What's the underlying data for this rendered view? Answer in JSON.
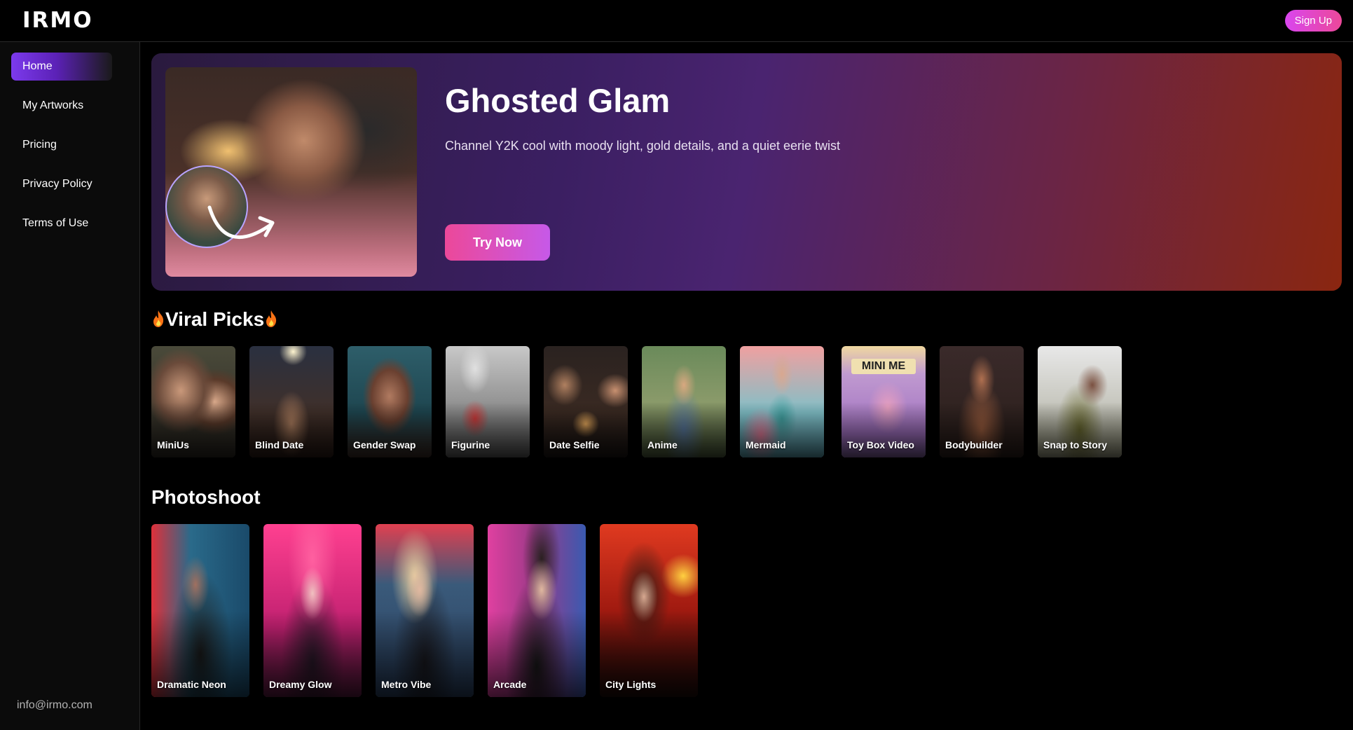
{
  "header": {
    "logo": "IRMO",
    "signup_label": "Sign Up"
  },
  "sidebar": {
    "items": [
      {
        "label": "Home",
        "active": true
      },
      {
        "label": "My Artworks"
      },
      {
        "label": "Pricing"
      },
      {
        "label": "Privacy Policy"
      },
      {
        "label": "Terms of Use"
      }
    ],
    "email": "info@irmo.com"
  },
  "hero": {
    "title": "Ghosted Glam",
    "description": "Channel Y2K cool with moody light, gold details, and a quiet eerie twist",
    "cta_label": "Try Now"
  },
  "viral": {
    "title": "Viral Picks",
    "items": [
      {
        "label": "MiniUs"
      },
      {
        "label": "Blind Date"
      },
      {
        "label": "Gender Swap"
      },
      {
        "label": "Figurine"
      },
      {
        "label": "Date Selfie"
      },
      {
        "label": "Anime"
      },
      {
        "label": "Mermaid"
      },
      {
        "label": "Toy Box Video",
        "badge": "MINI ME"
      },
      {
        "label": "Bodybuilder"
      },
      {
        "label": "Snap to Story"
      }
    ]
  },
  "photoshoot": {
    "title": "Photoshoot",
    "items": [
      {
        "label": "Dramatic Neon"
      },
      {
        "label": "Dreamy Glow"
      },
      {
        "label": "Metro Vibe"
      },
      {
        "label": "Arcade"
      },
      {
        "label": "City Lights"
      }
    ]
  },
  "colors": {
    "accent_pink": "#ec4899",
    "accent_purple": "#7c3aed",
    "background": "#000000"
  }
}
